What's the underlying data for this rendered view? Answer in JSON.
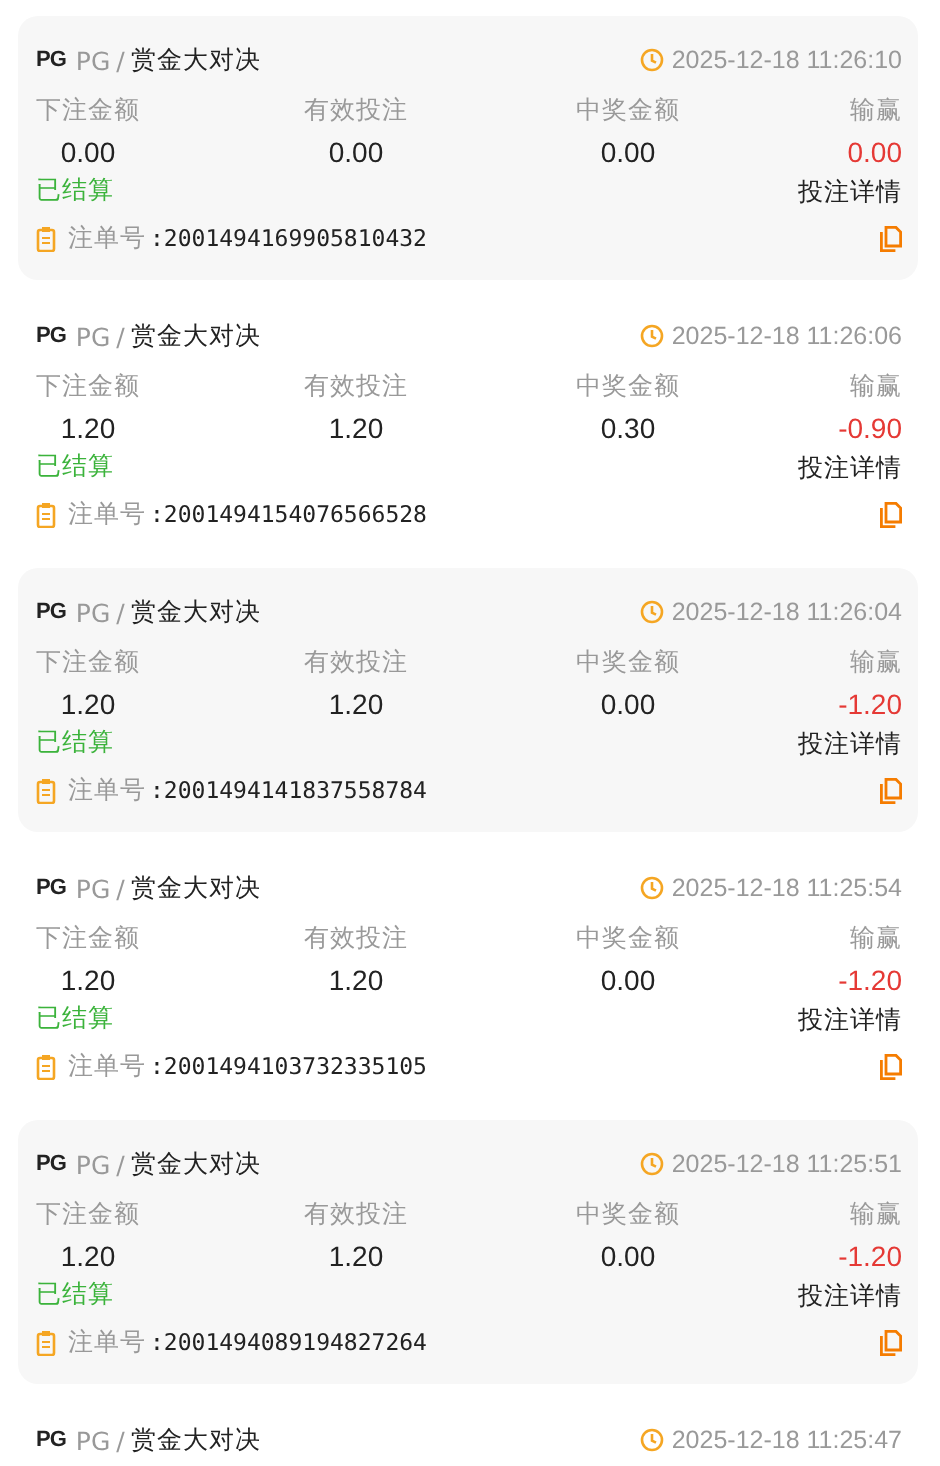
{
  "bets": [
    {
      "logo": "PG",
      "provider": "PG",
      "separator": "/",
      "game": "赏金大对决",
      "time": "2025-12-18 11:26:10",
      "labels": [
        "下注金额",
        "有效投注",
        "中奖金额",
        "输赢"
      ],
      "values": [
        "0.00",
        "0.00",
        "0.00",
        "0.00"
      ],
      "status": "已结算",
      "details": "投注详情",
      "order_label": "注单号",
      "order_no": ":2001494169905810432"
    },
    {
      "logo": "PG",
      "provider": "PG",
      "separator": "/",
      "game": "赏金大对决",
      "time": "2025-12-18 11:26:06",
      "labels": [
        "下注金额",
        "有效投注",
        "中奖金额",
        "输赢"
      ],
      "values": [
        "1.20",
        "1.20",
        "0.30",
        "-0.90"
      ],
      "status": "已结算",
      "details": "投注详情",
      "order_label": "注单号",
      "order_no": ":2001494154076566528"
    },
    {
      "logo": "PG",
      "provider": "PG",
      "separator": "/",
      "game": "赏金大对决",
      "time": "2025-12-18 11:26:04",
      "labels": [
        "下注金额",
        "有效投注",
        "中奖金额",
        "输赢"
      ],
      "values": [
        "1.20",
        "1.20",
        "0.00",
        "-1.20"
      ],
      "status": "已结算",
      "details": "投注详情",
      "order_label": "注单号",
      "order_no": ":2001494141837558784"
    },
    {
      "logo": "PG",
      "provider": "PG",
      "separator": "/",
      "game": "赏金大对决",
      "time": "2025-12-18 11:25:54",
      "labels": [
        "下注金额",
        "有效投注",
        "中奖金额",
        "输赢"
      ],
      "values": [
        "1.20",
        "1.20",
        "0.00",
        "-1.20"
      ],
      "status": "已结算",
      "details": "投注详情",
      "order_label": "注单号",
      "order_no": ":2001494103732335105"
    },
    {
      "logo": "PG",
      "provider": "PG",
      "separator": "/",
      "game": "赏金大对决",
      "time": "2025-12-18 11:25:51",
      "labels": [
        "下注金额",
        "有效投注",
        "中奖金额",
        "输赢"
      ],
      "values": [
        "1.20",
        "1.20",
        "0.00",
        "-1.20"
      ],
      "status": "已结算",
      "details": "投注详情",
      "order_label": "注单号",
      "order_no": ":2001494089194827264"
    },
    {
      "logo": "PG",
      "provider": "PG",
      "separator": "/",
      "game": "赏金大对决",
      "time": "2025-12-18 11:25:47"
    }
  ]
}
